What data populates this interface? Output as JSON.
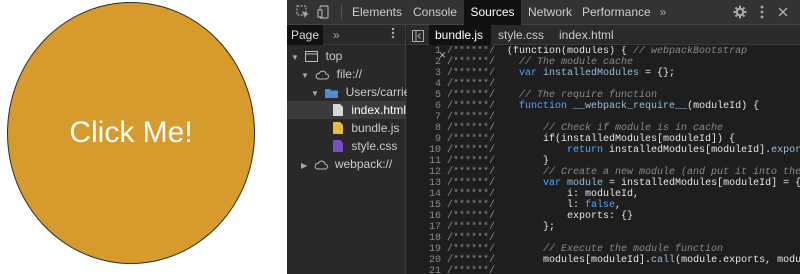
{
  "page": {
    "button_label": "Click Me!",
    "button_color": "#d69a2d"
  },
  "devtools": {
    "tabs": [
      "Elements",
      "Console",
      "Sources",
      "Network",
      "Performance"
    ],
    "active_tab": "Sources",
    "more_tabs": "»",
    "navigator": {
      "tab": "Page",
      "more": "»",
      "tree": [
        {
          "label": "top",
          "icon": "frame-icon",
          "expand": "▼"
        },
        {
          "label": "file://",
          "icon": "cloud-icon",
          "expand": "▼"
        },
        {
          "label": "Users/carriepas",
          "icon": "folder-icon",
          "expand": "▼"
        },
        {
          "label": "index.html",
          "icon": "file-icon",
          "selected": true
        },
        {
          "label": "bundle.js",
          "icon": "js-file-icon"
        },
        {
          "label": "style.css",
          "icon": "css-file-icon"
        },
        {
          "label": "webpack://",
          "icon": "cloud-icon",
          "expand": "▶"
        }
      ]
    },
    "editor": {
      "tabs": [
        {
          "label": "bundle.js",
          "close": "×",
          "active": true
        },
        {
          "label": "style.css"
        },
        {
          "label": "index.html"
        }
      ],
      "line_numbers": [
        "1",
        "2",
        "3",
        "4",
        "5",
        "6",
        "7",
        "8",
        "9",
        "10",
        "11",
        "12",
        "13",
        "14",
        "15",
        "16",
        "17",
        "18",
        "19",
        "20",
        "21"
      ],
      "lines": [
        [
          [
            "c",
            "/******/ "
          ],
          [
            "p",
            " (function(modules) { "
          ],
          [
            "c",
            "// webpackBootstrap"
          ]
        ],
        [
          [
            "c",
            "/******/ "
          ],
          [
            "c",
            "   // The module cache"
          ]
        ],
        [
          [
            "c",
            "/******/ "
          ],
          [
            "k",
            "   var "
          ],
          [
            "v",
            "installedModules"
          ],
          [
            "p",
            " = {};"
          ]
        ],
        [
          [
            "c",
            "/******/"
          ]
        ],
        [
          [
            "c",
            "/******/ "
          ],
          [
            "c",
            "   // The require function"
          ]
        ],
        [
          [
            "c",
            "/******/ "
          ],
          [
            "k",
            "   function "
          ],
          [
            "v",
            "__webpack_require__"
          ],
          [
            "p",
            "(moduleId) {"
          ]
        ],
        [
          [
            "c",
            "/******/"
          ]
        ],
        [
          [
            "c",
            "/******/ "
          ],
          [
            "c",
            "       // Check if module is in cache"
          ]
        ],
        [
          [
            "c",
            "/******/ "
          ],
          [
            "p",
            "       if(installedModules[moduleId]) {"
          ]
        ],
        [
          [
            "c",
            "/******/ "
          ],
          [
            "k",
            "           return "
          ],
          [
            "p",
            "installedModules[moduleId]."
          ],
          [
            "v",
            "exports"
          ],
          [
            "p",
            ";"
          ]
        ],
        [
          [
            "c",
            "/******/ "
          ],
          [
            "p",
            "       }"
          ]
        ],
        [
          [
            "c",
            "/******/ "
          ],
          [
            "c",
            "       // Create a new module (and put it into the ca"
          ]
        ],
        [
          [
            "c",
            "/******/ "
          ],
          [
            "k",
            "       var "
          ],
          [
            "v",
            "module"
          ],
          [
            "p",
            " = installedModules[moduleId] = {"
          ]
        ],
        [
          [
            "c",
            "/******/ "
          ],
          [
            "p",
            "           i: moduleId,"
          ]
        ],
        [
          [
            "c",
            "/******/ "
          ],
          [
            "p",
            "           l: "
          ],
          [
            "k",
            "false"
          ],
          [
            "p",
            ","
          ]
        ],
        [
          [
            "c",
            "/******/ "
          ],
          [
            "p",
            "           exports: {}"
          ]
        ],
        [
          [
            "c",
            "/******/ "
          ],
          [
            "p",
            "       };"
          ]
        ],
        [
          [
            "c",
            "/******/"
          ]
        ],
        [
          [
            "c",
            "/******/ "
          ],
          [
            "c",
            "       // Execute the module function"
          ]
        ],
        [
          [
            "c",
            "/******/ "
          ],
          [
            "p",
            "       modules[moduleId]."
          ],
          [
            "v",
            "call"
          ],
          [
            "p",
            "(module.exports, module, m"
          ]
        ],
        [
          [
            "c",
            "/******/"
          ]
        ]
      ]
    },
    "colors": {
      "comment": "#8a8a8a",
      "keyword": "#4fa8ff",
      "var": "#9bbbdc",
      "plain": "#e6e6e6"
    }
  }
}
